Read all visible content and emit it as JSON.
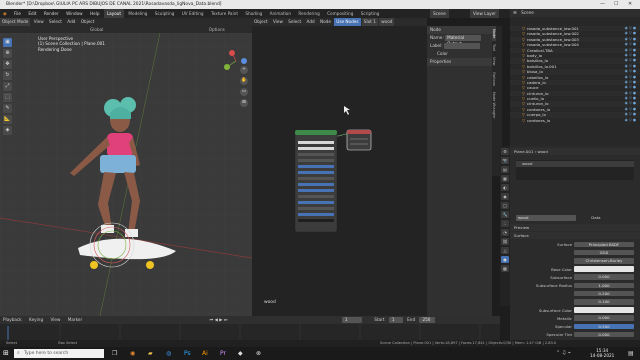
{
  "window": {
    "title": "Blender* [D:\\Dropbox\\ GIULIA PC ARS DIBUJOS DE CANAL 2021\\Rosadavasda_ligNova_Data.blend]",
    "controls": [
      "—",
      "☐",
      "✕"
    ]
  },
  "menu": {
    "items": [
      "File",
      "Edit",
      "Render",
      "Window",
      "Help"
    ],
    "tabs": [
      "Layout",
      "Modeling",
      "Sculpting",
      "UV Editing",
      "Texture Paint",
      "Shading",
      "Animation",
      "Rendering",
      "Compositing",
      "Scripting"
    ],
    "active_tab": "Layout",
    "scene_label": "Scene",
    "view_layer_label": "View Layer"
  },
  "viewport": {
    "header": [
      "Object Mode",
      "View",
      "Select",
      "Add",
      "Object"
    ],
    "header2": [
      "Global",
      "Options"
    ],
    "info_lines": [
      "User Perspective",
      "(1) Scene Collection | Plane.001",
      "Rendering Done"
    ],
    "tools": [
      "cursor-icon",
      "move-icon",
      "rotate-icon",
      "scale-icon",
      "transform-icon",
      "annotate-icon",
      "measure-icon",
      "add-cube-icon"
    ],
    "nav": [
      "zoom-icon",
      "pan-icon",
      "camera-icon",
      "ortho-icon"
    ]
  },
  "node_editor": {
    "header": [
      "Object",
      "View",
      "Select",
      "Add",
      "Node",
      "Use Nodes",
      "Slot 1",
      "wood"
    ],
    "label": "wood",
    "node_title": "Principled BSDF",
    "output_title": "Material Output"
  },
  "npanel": {
    "section": "Node",
    "name_label": "Name:",
    "name_value": "Material Output",
    "label_label": "Label:",
    "color_label": "Color",
    "properties_label": "Properties",
    "tabs": [
      "Node",
      "Tool",
      "View",
      "Options",
      "Node Wrangler"
    ]
  },
  "outliner": {
    "title": "Scene",
    "rows": [
      "rosada_substance_low.001",
      "rosada_substance_low.002",
      "rosada_substance_low.003",
      "rosada_substance_low.004",
      "Crealical.TBA",
      "body_lo",
      "bolsillos_lo",
      "bolsillos_lo.001",
      "blusa_lo",
      "cabellos_lo",
      "cadera_lo",
      "cauce",
      "cinturon_lo",
      "cuello_lo",
      "cinturon_lo",
      "cordones_lo",
      "cuerpo_lo",
      "cordones_lo"
    ]
  },
  "properties": {
    "path": [
      "Plane.001",
      "wood"
    ],
    "material": "wood",
    "slot_label": "wood",
    "data_label": "Data",
    "section_preview": "Preview",
    "section_surface": "Surface",
    "rows": [
      {
        "label": "Surface",
        "value": "Principled BSDF"
      },
      {
        "label": "",
        "value": "GGX"
      },
      {
        "label": "",
        "value": "Christensen-Burley"
      },
      {
        "label": "Base Color",
        "value": ""
      },
      {
        "label": "Subsurface",
        "value": "0.000"
      },
      {
        "label": "Subsurface Radius",
        "value": "1.000"
      },
      {
        "label": "",
        "value": "0.200"
      },
      {
        "label": "",
        "value": "0.100"
      },
      {
        "label": "Subsurface Color",
        "value": ""
      },
      {
        "label": "Metallic",
        "value": "0.000"
      },
      {
        "label": "Specular",
        "value": "0.500"
      },
      {
        "label": "Specular Tint",
        "value": "0.000"
      }
    ]
  },
  "timeline": {
    "header": [
      "Playback",
      "Keying",
      "View",
      "Marker"
    ],
    "frame": "1",
    "start_label": "Start",
    "start": "1",
    "end_label": "End",
    "end": "250"
  },
  "status": {
    "left": "Select",
    "mid": "Box Select",
    "right": "Scene Collection | Plane.001 | Verts:18,897 | Faces:17,841 | Objects:0/30 | Mem: 1.47 GiB | 2.83.0"
  },
  "taskbar": {
    "search_placeholder": "Type here to search",
    "time": "15:34",
    "date": "14-08-2021"
  }
}
